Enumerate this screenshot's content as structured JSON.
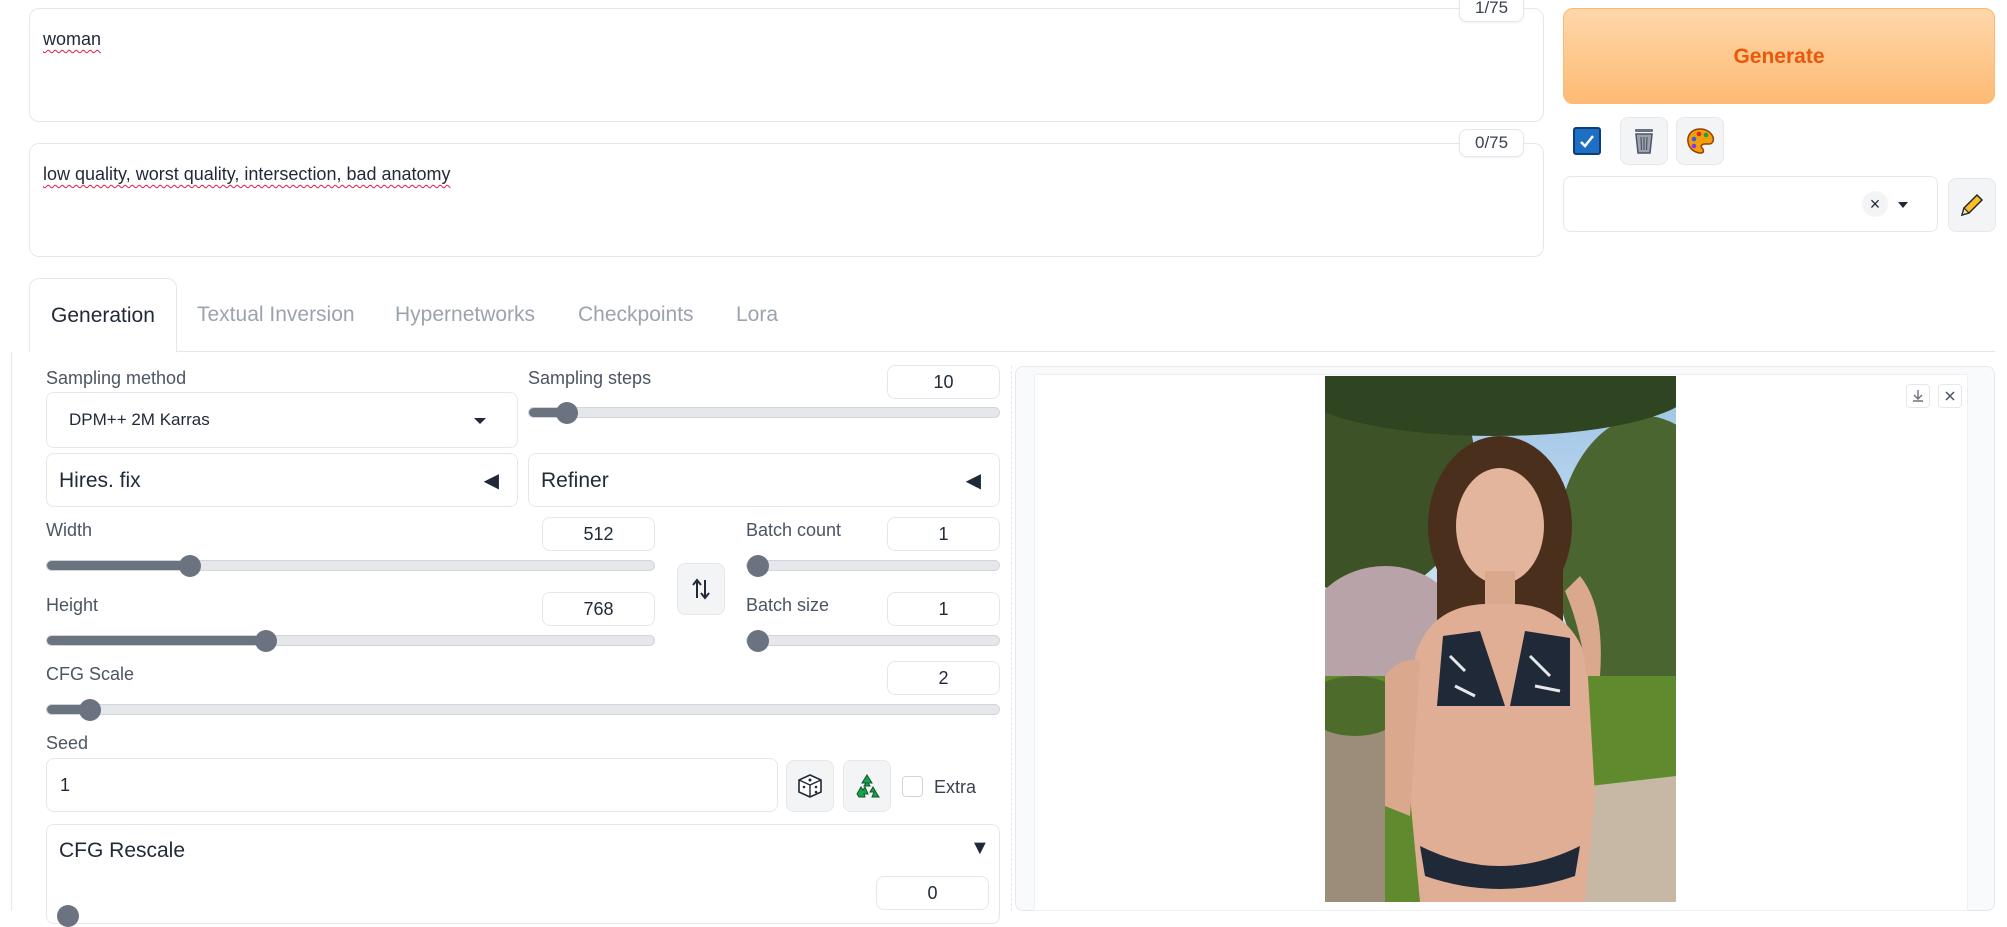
{
  "prompt": {
    "text": "woman",
    "counter": "1/75"
  },
  "negative_prompt": {
    "text": "low quality, worst quality, intersection, bad anatomy",
    "counter": "0/75"
  },
  "actions": {
    "generate_label": "Generate",
    "accent_color": "#ea580c",
    "icons": [
      "checkbox-icon",
      "trash-icon",
      "palette-icon"
    ]
  },
  "styles": {
    "clear_glyph": "×",
    "edit_icon": "pencil-icon"
  },
  "tabs": [
    {
      "label": "Generation",
      "active": true
    },
    {
      "label": "Textual Inversion",
      "active": false
    },
    {
      "label": "Hypernetworks",
      "active": false
    },
    {
      "label": "Checkpoints",
      "active": false
    },
    {
      "label": "Lora",
      "active": false
    }
  ],
  "settings": {
    "sampling_method": {
      "label": "Sampling method",
      "value": "DPM++ 2M Karras"
    },
    "sampling_steps": {
      "label": "Sampling steps",
      "value": "10",
      "fraction": 0.08
    },
    "hires_fix": {
      "label": "Hires. fix",
      "arrow": "◀"
    },
    "refiner": {
      "label": "Refiner",
      "arrow": "◀"
    },
    "width": {
      "label": "Width",
      "value": "512",
      "fraction": 0.235
    },
    "height": {
      "label": "Height",
      "value": "768",
      "fraction": 0.36
    },
    "swap_icon": "swap-dimensions-icon",
    "batch_count": {
      "label": "Batch count",
      "value": "1",
      "fraction": 0.0
    },
    "batch_size": {
      "label": "Batch size",
      "value": "1",
      "fraction": 0.0
    },
    "cfg_scale": {
      "label": "CFG Scale",
      "value": "2",
      "fraction": 0.045
    },
    "seed": {
      "label": "Seed",
      "value": "1",
      "extra_label": "Extra"
    },
    "cfg_rescale": {
      "label": "CFG Rescale",
      "arrow": "▼",
      "value": "0"
    }
  },
  "output": {
    "download_icon": "download-icon",
    "close_icon": "close-icon"
  }
}
